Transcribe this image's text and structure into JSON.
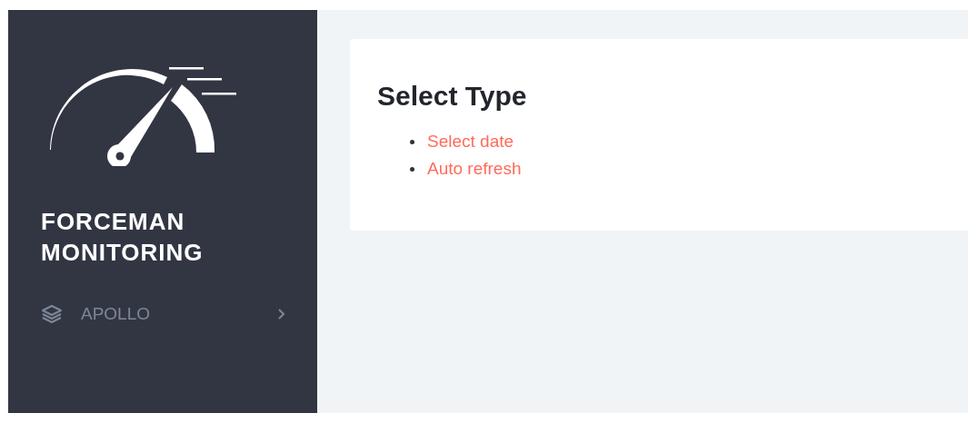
{
  "sidebar": {
    "brand": [
      "FORCEMAN",
      "MONITORING"
    ],
    "items": [
      {
        "label": "APOLLO",
        "expanded": false
      }
    ]
  },
  "card": {
    "title": "Select Type",
    "links": [
      {
        "label": "Select date"
      },
      {
        "label": "Auto refresh"
      }
    ]
  }
}
